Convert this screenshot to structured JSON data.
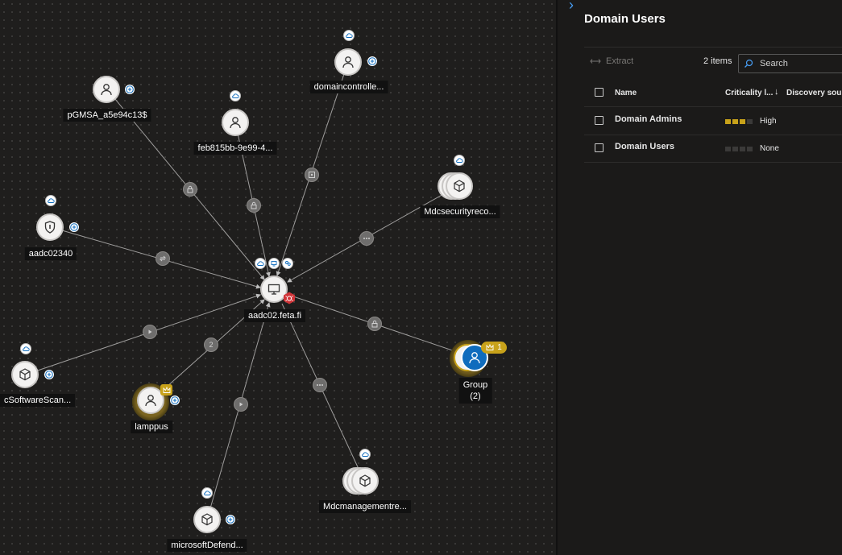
{
  "panel": {
    "title": "Domain Users",
    "extract_label": "Extract",
    "items_count": "2 items",
    "search_placeholder": "Search",
    "columns": {
      "name": "Name",
      "criticality": "Criticality l...",
      "discovery": "Discovery sourc"
    },
    "rows": [
      {
        "name": "Domain Admins",
        "criticality": "High",
        "level": 3,
        "color": "#c8a21a"
      },
      {
        "name": "Domain Users",
        "criticality": "None",
        "level": 0,
        "color": "#3b3a39"
      }
    ]
  },
  "graph": {
    "center_label": "aadc02.feta.fi",
    "node_labels": {
      "pgmsa": "pGMSA_a5e94c13$",
      "feb": "feb815bb-9e99-4...",
      "dc": "domaincontrolle...",
      "mdcsec": "Mdcsecurityreco...",
      "aadc": "aadc02340",
      "software": "cSoftwareScan...",
      "lamppus": "lamppus",
      "defender": "microsoftDefend...",
      "mdcmgmt": "Mdcmanagementre...",
      "group": "Group",
      "group_count": "(2)"
    },
    "group_badge": "1",
    "edge_count": "2"
  }
}
